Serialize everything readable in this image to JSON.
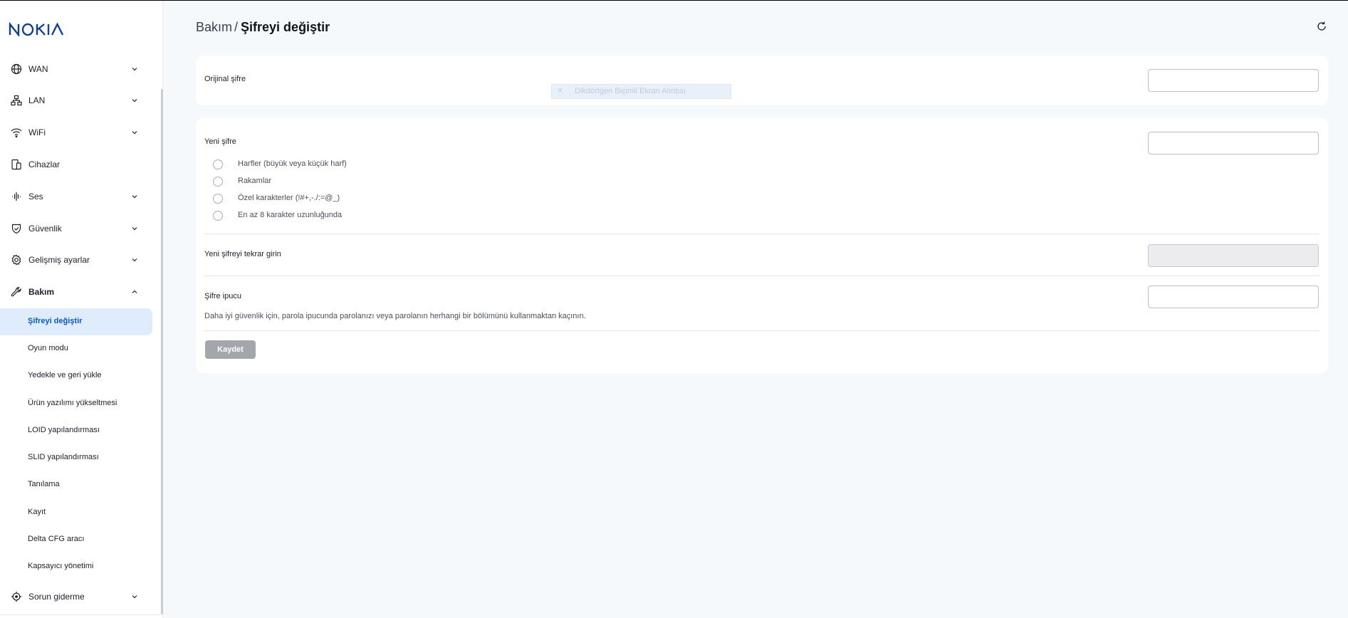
{
  "brand": {
    "logo_text": "NOKIA",
    "accent": "#124191",
    "active_color": "#0a57c2"
  },
  "sidebar": {
    "items": [
      {
        "label": "WAN",
        "icon": "globe-icon",
        "expanded": false
      },
      {
        "label": "LAN",
        "icon": "network-icon",
        "expanded": false
      },
      {
        "label": "WiFi",
        "icon": "wifi-icon",
        "expanded": false
      },
      {
        "label": "Cihazlar",
        "icon": "devices-icon"
      },
      {
        "label": "Ses",
        "icon": "audio-icon",
        "expanded": false
      },
      {
        "label": "Güvenlik",
        "icon": "shield-icon",
        "expanded": false
      },
      {
        "label": "Gelişmiş ayarlar",
        "icon": "gear-icon",
        "expanded": false
      },
      {
        "label": "Bakım",
        "icon": "wrench-icon",
        "expanded": true
      },
      {
        "label": "Sorun giderme",
        "icon": "crosshair-icon",
        "expanded": false
      }
    ],
    "subitems": [
      {
        "label": "Şifreyi değiştir",
        "active": true
      },
      {
        "label": "Oyun modu"
      },
      {
        "label": "Yedekle ve geri yükle"
      },
      {
        "label": "Ürün yazılımı yükseltmesi"
      },
      {
        "label": "LOID yapılandırması"
      },
      {
        "label": "SLID yapılandırması"
      },
      {
        "label": "Tanılama"
      },
      {
        "label": "Kayıt"
      },
      {
        "label": "Delta CFG aracı"
      },
      {
        "label": "Kapsayıcı yönetimi"
      }
    ]
  },
  "header": {
    "breadcrumb_parent": "Bakım",
    "breadcrumb_sep": "/",
    "breadcrumb_current": "Şifreyi değiştir",
    "refresh_icon": "refresh-icon"
  },
  "form": {
    "original_password": {
      "label": "Orijinal şifre",
      "value": ""
    },
    "new_password": {
      "label": "Yeni şifre",
      "value": ""
    },
    "requirements": [
      "Harfler (büyük veya küçük harf)",
      "Rakamlar",
      "Özel karakterler (!#+,-./:=@_)",
      "En az 8 karakter uzunluğunda"
    ],
    "confirm_password": {
      "label": "Yeni şifreyi tekrar girin",
      "value": "",
      "disabled": true
    },
    "hint": {
      "label": "Şifre ipucu",
      "value": "",
      "note": "Daha iyi güvenlik için, parola ipucunda parolanızı veya parolanın herhangi bir bölümünü kullanmaktan kaçının."
    },
    "save_label": "Kaydet"
  },
  "overlay": {
    "snip_label": "Dikdörtgen Biçimli Ekran Alıntısı",
    "close_glyph": "✕"
  }
}
